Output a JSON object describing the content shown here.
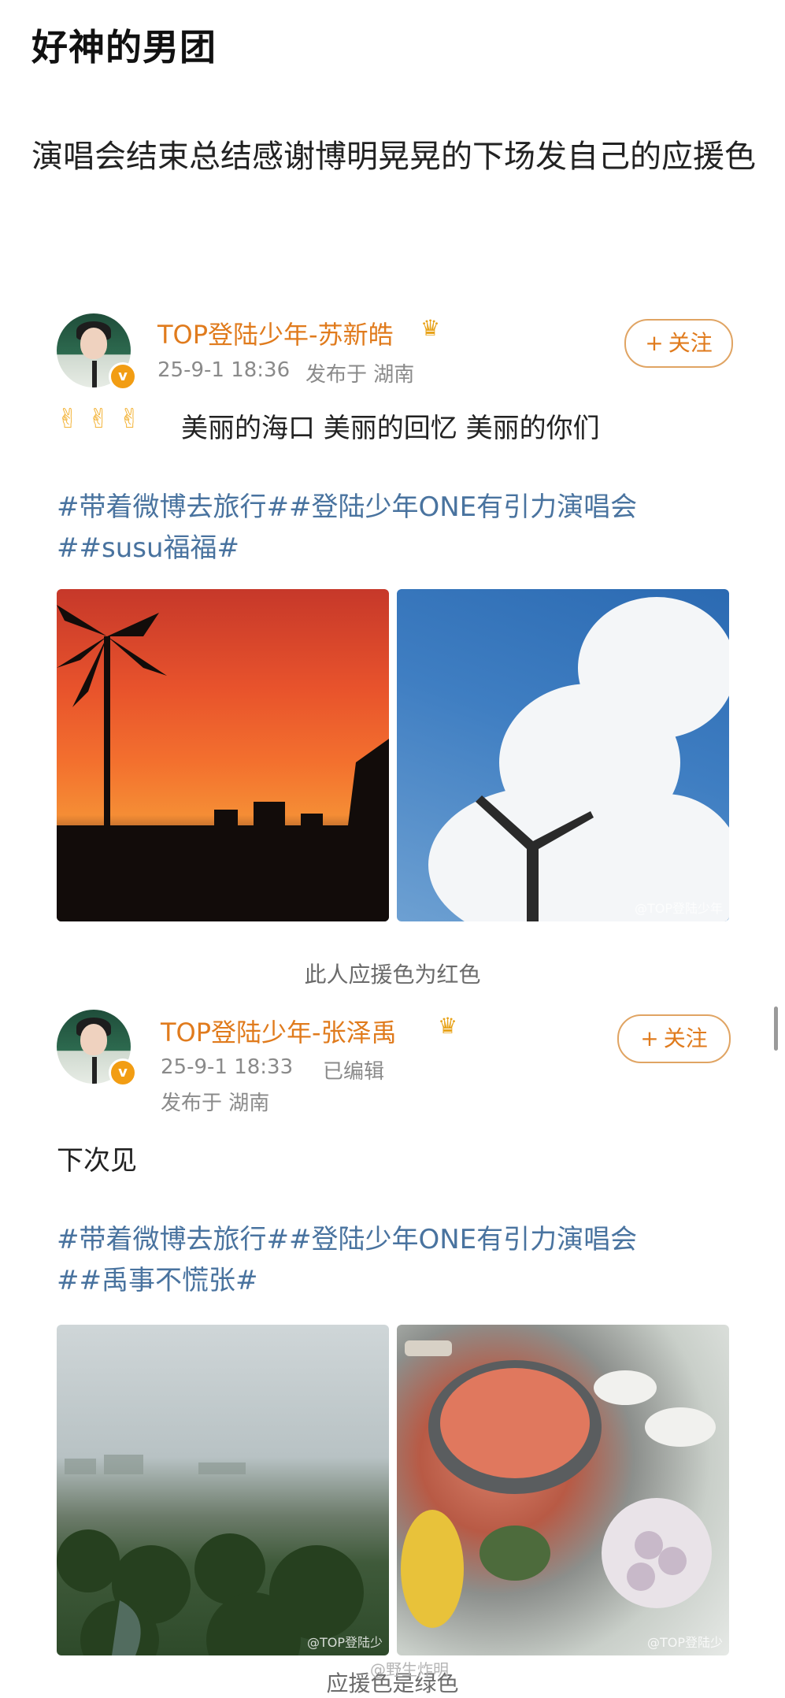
{
  "title": "好神的男团",
  "body": "演唱会结束总结感谢博明晃晃的下场发自己的应援色",
  "posts": [
    {
      "name": "TOP登陆少年-苏新皓",
      "crown": "♛",
      "verified": "v",
      "time": "25-9-1 18:36",
      "location": "发布于 湖南",
      "follow": "关注",
      "emojis": "✌ ✌ ✌",
      "text": "美丽的海口 美丽的回忆 美丽的你们",
      "hashtags_line1": "#带着微博去旅行##登陆少年ONE有引力演唱会",
      "hashtags_line2": "##susu福福#",
      "photos": [
        "sunset-palm-photo",
        "blue-sky-cloud-photo"
      ],
      "photo_watermark": "@TOP登陆少年"
    },
    {
      "name": "TOP登陆少年-张泽禹",
      "crown": "♛",
      "verified": "v",
      "time": "25-9-1 18:33",
      "edited": "已编辑",
      "location": "发布于 湖南",
      "follow": "关注",
      "text": "下次见",
      "hashtags_line1": "#带着微博去旅行##登陆少年ONE有引力演唱会",
      "hashtags_line2": "##禹事不慌张#",
      "photos": [
        "green-landscape-photo",
        "hotpot-table-photo"
      ],
      "photo_watermark_1": "@TOP登陆少",
      "photo_watermark_2": "@TOP登陆少"
    }
  ],
  "captions": {
    "first": "此人应援色为红色",
    "second": "应援色是绿色",
    "weibo_watermark": "@野生炸明"
  },
  "colors": {
    "name": "#e07b1d",
    "hashtag": "#49739f",
    "meta": "#8a8a8a"
  }
}
